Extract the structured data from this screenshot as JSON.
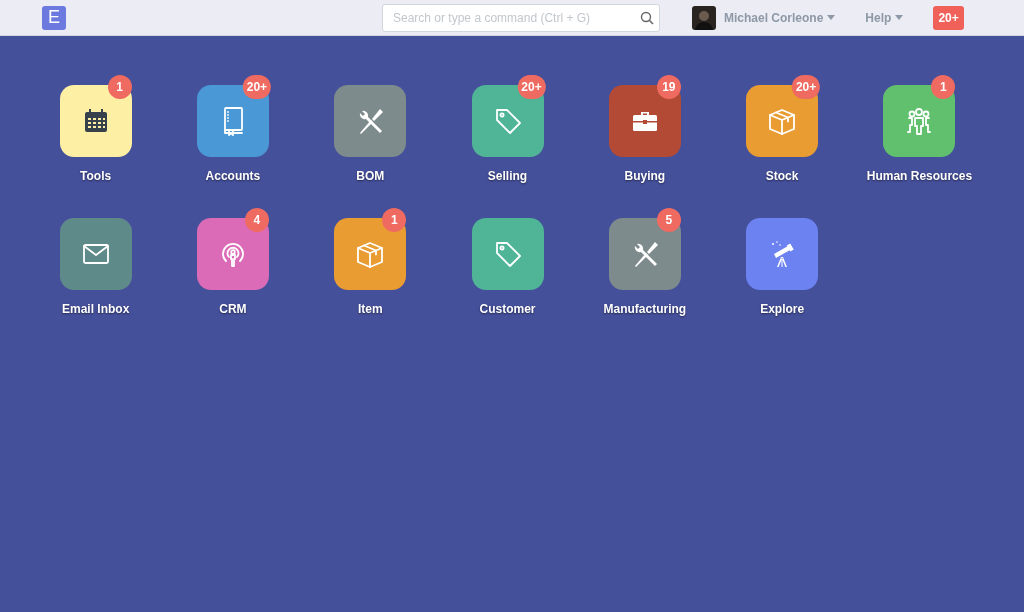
{
  "navbar": {
    "logo": "E",
    "search": {
      "placeholder": "Search or type a command (Ctrl + G)"
    },
    "user": {
      "name": "Michael Corleone"
    },
    "help": "Help",
    "notifications": "20+"
  },
  "modules": [
    {
      "label": "Tools",
      "kind": "calendar",
      "color": "#fdf0a5",
      "badge": "1"
    },
    {
      "label": "Accounts",
      "kind": "book",
      "color": "#4a98d6",
      "badge": "20+"
    },
    {
      "label": "BOM",
      "kind": "tools",
      "color": "#7e8b8c"
    },
    {
      "label": "Selling",
      "kind": "tag",
      "color": "#4fb596",
      "badge": "20+"
    },
    {
      "label": "Buying",
      "kind": "briefcase",
      "color": "#b34a35",
      "badge": "19"
    },
    {
      "label": "Stock",
      "kind": "box",
      "color": "#e89c31",
      "badge": "20+"
    },
    {
      "label": "Human Resources",
      "kind": "people",
      "color": "#61c06d",
      "badge": "1"
    },
    {
      "label": "Email Inbox",
      "kind": "envelope",
      "color": "#5f8a8a"
    },
    {
      "label": "CRM",
      "kind": "podcast",
      "color": "#db6bb6",
      "badge": "4"
    },
    {
      "label": "Item",
      "kind": "box",
      "color": "#e89c31",
      "badge": "1"
    },
    {
      "label": "Customer",
      "kind": "tag",
      "color": "#4fb596"
    },
    {
      "label": "Manufacturing",
      "kind": "tools",
      "color": "#7e8b8c",
      "badge": "5"
    },
    {
      "label": "Explore",
      "kind": "telescope",
      "color": "#6c82f0"
    }
  ]
}
